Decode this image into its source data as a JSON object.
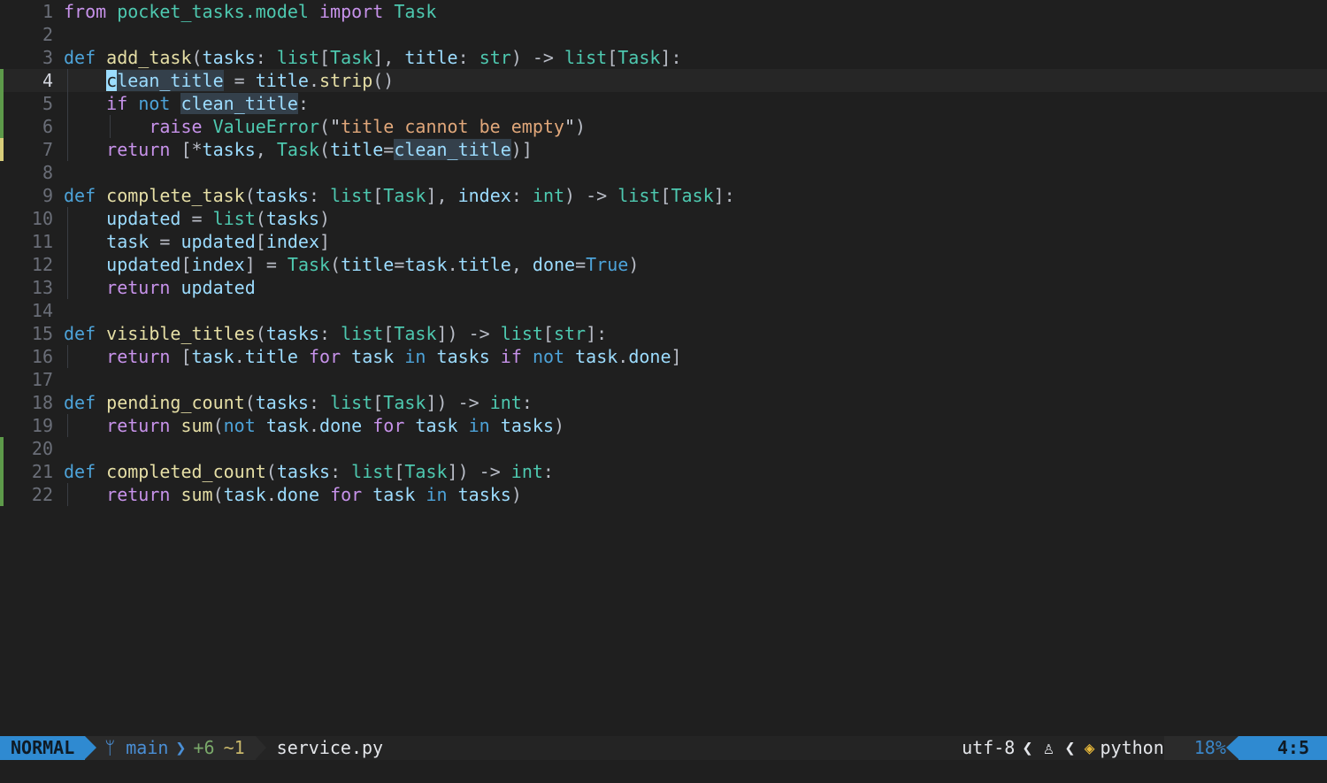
{
  "editor": {
    "lines": [
      {
        "n": "1",
        "git": "",
        "guides": [],
        "tokens": [
          [
            "kw",
            "from"
          ],
          [
            "pl",
            " "
          ],
          [
            "ty",
            "pocket_tasks.model"
          ],
          [
            "pl",
            " "
          ],
          [
            "kw",
            "import"
          ],
          [
            "pl",
            " "
          ],
          [
            "ty",
            "Task"
          ]
        ]
      },
      {
        "n": "2",
        "git": "",
        "guides": [],
        "tokens": []
      },
      {
        "n": "3",
        "git": "",
        "guides": [],
        "tokens": [
          [
            "kw2",
            "def"
          ],
          [
            "pl",
            " "
          ],
          [
            "fn",
            "add_task"
          ],
          [
            "pl",
            "("
          ],
          [
            "var",
            "tasks"
          ],
          [
            "pl",
            ": "
          ],
          [
            "ty",
            "list"
          ],
          [
            "pl",
            "["
          ],
          [
            "ty",
            "Task"
          ],
          [
            "pl",
            "], "
          ],
          [
            "var",
            "title"
          ],
          [
            "pl",
            ": "
          ],
          [
            "ty",
            "str"
          ],
          [
            "pl",
            ") -> "
          ],
          [
            "ty",
            "list"
          ],
          [
            "pl",
            "["
          ],
          [
            "ty",
            "Task"
          ],
          [
            "pl",
            "]:"
          ]
        ]
      },
      {
        "n": "4",
        "git": "added",
        "current": true,
        "guides": [
          1
        ],
        "tokens": [
          [
            "pl",
            "    "
          ],
          [
            "cursor",
            "c"
          ],
          [
            "var hl",
            "lean_title"
          ],
          [
            "pl",
            " = "
          ],
          [
            "var",
            "title"
          ],
          [
            "pl",
            "."
          ],
          [
            "fn",
            "strip"
          ],
          [
            "pl",
            "()"
          ]
        ]
      },
      {
        "n": "5",
        "git": "added",
        "guides": [
          1
        ],
        "tokens": [
          [
            "pl",
            "    "
          ],
          [
            "kw",
            "if"
          ],
          [
            "pl",
            " "
          ],
          [
            "kw2",
            "not"
          ],
          [
            "pl",
            " "
          ],
          [
            "var hl",
            "clean_title"
          ],
          [
            "pl",
            ":"
          ]
        ]
      },
      {
        "n": "6",
        "git": "added",
        "guides": [
          1,
          2
        ],
        "tokens": [
          [
            "pl",
            "        "
          ],
          [
            "kw",
            "raise"
          ],
          [
            "pl",
            " "
          ],
          [
            "ty",
            "ValueError"
          ],
          [
            "pl",
            "("
          ],
          [
            "str-q",
            "\""
          ],
          [
            "str",
            "title cannot be empty"
          ],
          [
            "str-q",
            "\""
          ],
          [
            "pl",
            ")"
          ]
        ]
      },
      {
        "n": "7",
        "git": "modified",
        "guides": [
          1
        ],
        "tokens": [
          [
            "pl",
            "    "
          ],
          [
            "kw",
            "return"
          ],
          [
            "pl",
            " [*"
          ],
          [
            "var",
            "tasks"
          ],
          [
            "pl",
            ", "
          ],
          [
            "ty",
            "Task"
          ],
          [
            "pl",
            "("
          ],
          [
            "var",
            "title"
          ],
          [
            "pl",
            "="
          ],
          [
            "var hl",
            "clean_title"
          ],
          [
            "pl",
            ")]"
          ]
        ]
      },
      {
        "n": "8",
        "git": "",
        "guides": [],
        "tokens": []
      },
      {
        "n": "9",
        "git": "",
        "guides": [],
        "tokens": [
          [
            "kw2",
            "def"
          ],
          [
            "pl",
            " "
          ],
          [
            "fn",
            "complete_task"
          ],
          [
            "pl",
            "("
          ],
          [
            "var",
            "tasks"
          ],
          [
            "pl",
            ": "
          ],
          [
            "ty",
            "list"
          ],
          [
            "pl",
            "["
          ],
          [
            "ty",
            "Task"
          ],
          [
            "pl",
            "], "
          ],
          [
            "var",
            "index"
          ],
          [
            "pl",
            ": "
          ],
          [
            "ty",
            "int"
          ],
          [
            "pl",
            ") -> "
          ],
          [
            "ty",
            "list"
          ],
          [
            "pl",
            "["
          ],
          [
            "ty",
            "Task"
          ],
          [
            "pl",
            "]:"
          ]
        ]
      },
      {
        "n": "10",
        "git": "",
        "guides": [
          1
        ],
        "tokens": [
          [
            "pl",
            "    "
          ],
          [
            "var",
            "updated"
          ],
          [
            "pl",
            " = "
          ],
          [
            "ty",
            "list"
          ],
          [
            "pl",
            "("
          ],
          [
            "var",
            "tasks"
          ],
          [
            "pl",
            ")"
          ]
        ]
      },
      {
        "n": "11",
        "git": "",
        "guides": [
          1
        ],
        "tokens": [
          [
            "pl",
            "    "
          ],
          [
            "var",
            "task"
          ],
          [
            "pl",
            " = "
          ],
          [
            "var",
            "updated"
          ],
          [
            "pl",
            "["
          ],
          [
            "var",
            "index"
          ],
          [
            "pl",
            "]"
          ]
        ]
      },
      {
        "n": "12",
        "git": "",
        "guides": [
          1
        ],
        "tokens": [
          [
            "pl",
            "    "
          ],
          [
            "var",
            "updated"
          ],
          [
            "pl",
            "["
          ],
          [
            "var",
            "index"
          ],
          [
            "pl",
            "] = "
          ],
          [
            "ty",
            "Task"
          ],
          [
            "pl",
            "("
          ],
          [
            "var",
            "title"
          ],
          [
            "pl",
            "="
          ],
          [
            "var",
            "task"
          ],
          [
            "pl",
            "."
          ],
          [
            "var",
            "title"
          ],
          [
            "pl",
            ", "
          ],
          [
            "var",
            "done"
          ],
          [
            "pl",
            "="
          ],
          [
            "kw2",
            "True"
          ],
          [
            "pl",
            ")"
          ]
        ]
      },
      {
        "n": "13",
        "git": "",
        "guides": [
          1
        ],
        "tokens": [
          [
            "pl",
            "    "
          ],
          [
            "kw",
            "return"
          ],
          [
            "pl",
            " "
          ],
          [
            "var",
            "updated"
          ]
        ]
      },
      {
        "n": "14",
        "git": "",
        "guides": [],
        "tokens": []
      },
      {
        "n": "15",
        "git": "",
        "guides": [],
        "tokens": [
          [
            "kw2",
            "def"
          ],
          [
            "pl",
            " "
          ],
          [
            "fn",
            "visible_titles"
          ],
          [
            "pl",
            "("
          ],
          [
            "var",
            "tasks"
          ],
          [
            "pl",
            ": "
          ],
          [
            "ty",
            "list"
          ],
          [
            "pl",
            "["
          ],
          [
            "ty",
            "Task"
          ],
          [
            "pl",
            "]) -> "
          ],
          [
            "ty",
            "list"
          ],
          [
            "pl",
            "["
          ],
          [
            "ty",
            "str"
          ],
          [
            "pl",
            "]:"
          ]
        ]
      },
      {
        "n": "16",
        "git": "",
        "guides": [
          1
        ],
        "tokens": [
          [
            "pl",
            "    "
          ],
          [
            "kw",
            "return"
          ],
          [
            "pl",
            " ["
          ],
          [
            "var",
            "task"
          ],
          [
            "pl",
            "."
          ],
          [
            "var",
            "title"
          ],
          [
            "pl",
            " "
          ],
          [
            "kw",
            "for"
          ],
          [
            "pl",
            " "
          ],
          [
            "var",
            "task"
          ],
          [
            "pl",
            " "
          ],
          [
            "kw2",
            "in"
          ],
          [
            "pl",
            " "
          ],
          [
            "var",
            "tasks"
          ],
          [
            "pl",
            " "
          ],
          [
            "kw",
            "if"
          ],
          [
            "pl",
            " "
          ],
          [
            "kw2",
            "not"
          ],
          [
            "pl",
            " "
          ],
          [
            "var",
            "task"
          ],
          [
            "pl",
            "."
          ],
          [
            "var",
            "done"
          ],
          [
            "pl",
            "]"
          ]
        ]
      },
      {
        "n": "17",
        "git": "",
        "guides": [],
        "tokens": []
      },
      {
        "n": "18",
        "git": "",
        "guides": [],
        "tokens": [
          [
            "kw2",
            "def"
          ],
          [
            "pl",
            " "
          ],
          [
            "fn",
            "pending_count"
          ],
          [
            "pl",
            "("
          ],
          [
            "var",
            "tasks"
          ],
          [
            "pl",
            ": "
          ],
          [
            "ty",
            "list"
          ],
          [
            "pl",
            "["
          ],
          [
            "ty",
            "Task"
          ],
          [
            "pl",
            "]) -> "
          ],
          [
            "ty",
            "int"
          ],
          [
            "pl",
            ":"
          ]
        ]
      },
      {
        "n": "19",
        "git": "",
        "guides": [
          1
        ],
        "tokens": [
          [
            "pl",
            "    "
          ],
          [
            "kw",
            "return"
          ],
          [
            "pl",
            " "
          ],
          [
            "fn",
            "sum"
          ],
          [
            "pl",
            "("
          ],
          [
            "kw2",
            "not"
          ],
          [
            "pl",
            " "
          ],
          [
            "var",
            "task"
          ],
          [
            "pl",
            "."
          ],
          [
            "var",
            "done"
          ],
          [
            "pl",
            " "
          ],
          [
            "kw",
            "for"
          ],
          [
            "pl",
            " "
          ],
          [
            "var",
            "task"
          ],
          [
            "pl",
            " "
          ],
          [
            "kw2",
            "in"
          ],
          [
            "pl",
            " "
          ],
          [
            "var",
            "tasks"
          ],
          [
            "pl",
            ")"
          ]
        ]
      },
      {
        "n": "20",
        "git": "added",
        "guides": [],
        "tokens": []
      },
      {
        "n": "21",
        "git": "added",
        "guides": [],
        "tokens": [
          [
            "kw2",
            "def"
          ],
          [
            "pl",
            " "
          ],
          [
            "fn",
            "completed_count"
          ],
          [
            "pl",
            "("
          ],
          [
            "var",
            "tasks"
          ],
          [
            "pl",
            ": "
          ],
          [
            "ty",
            "list"
          ],
          [
            "pl",
            "["
          ],
          [
            "ty",
            "Task"
          ],
          [
            "pl",
            "]) -> "
          ],
          [
            "ty",
            "int"
          ],
          [
            "pl",
            ":"
          ]
        ]
      },
      {
        "n": "22",
        "git": "added",
        "guides": [
          1
        ],
        "tokens": [
          [
            "pl",
            "    "
          ],
          [
            "kw",
            "return"
          ],
          [
            "pl",
            " "
          ],
          [
            "fn",
            "sum"
          ],
          [
            "pl",
            "("
          ],
          [
            "var",
            "task"
          ],
          [
            "pl",
            "."
          ],
          [
            "var",
            "done"
          ],
          [
            "pl",
            " "
          ],
          [
            "kw",
            "for"
          ],
          [
            "pl",
            " "
          ],
          [
            "var",
            "task"
          ],
          [
            "pl",
            " "
          ],
          [
            "kw2",
            "in"
          ],
          [
            "pl",
            " "
          ],
          [
            "var",
            "tasks"
          ],
          [
            "pl",
            ")"
          ]
        ]
      }
    ]
  },
  "statusline": {
    "mode": "NORMAL",
    "branch_icon": "ᛘ",
    "branch": "main",
    "diff_added": "+6",
    "diff_modified": "~1",
    "filename": "service.py",
    "encoding": "utf-8",
    "os_icon": "♙",
    "lang_icon": "◈",
    "filetype": "python",
    "percent": "18%",
    "position": "4:5"
  }
}
